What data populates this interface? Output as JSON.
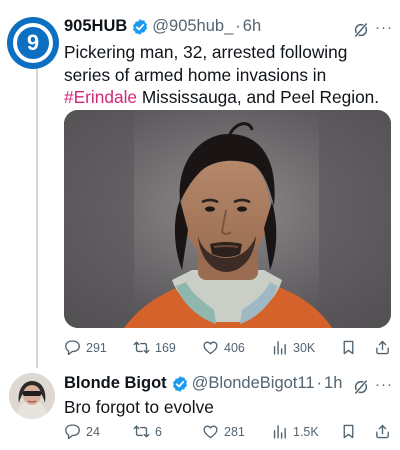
{
  "tweet1": {
    "avatar_text": "9",
    "name": "905HUB",
    "handle": "@905hub_",
    "dot": "·",
    "time": "6h",
    "more": "···",
    "text_before": "Pickering man, 32, arrested following series of armed home invasions in ",
    "hashtag": "#Erindale",
    "text_after": " Mississauga, and Peel Region.",
    "stats": {
      "replies": "291",
      "reposts": "169",
      "likes": "406",
      "views": "30K"
    }
  },
  "tweet2": {
    "name": "Blonde Bigot",
    "handle": "@BlondeBigot11",
    "dot": "·",
    "time": "1h",
    "more": "···",
    "text": "Bro forgot to evolve",
    "stats": {
      "replies": "24",
      "reposts": "6",
      "likes": "281",
      "views": "1.5K"
    }
  },
  "colors": {
    "verified": "#1d9bf0",
    "hashtag": "#d2287a",
    "avatar_905": "#0d6fc2",
    "secondary_text": "#536471"
  },
  "icons": [
    "verified-badge-icon",
    "grok-icon",
    "reply-icon",
    "repost-icon",
    "like-icon",
    "views-icon",
    "bookmark-icon",
    "share-icon"
  ]
}
